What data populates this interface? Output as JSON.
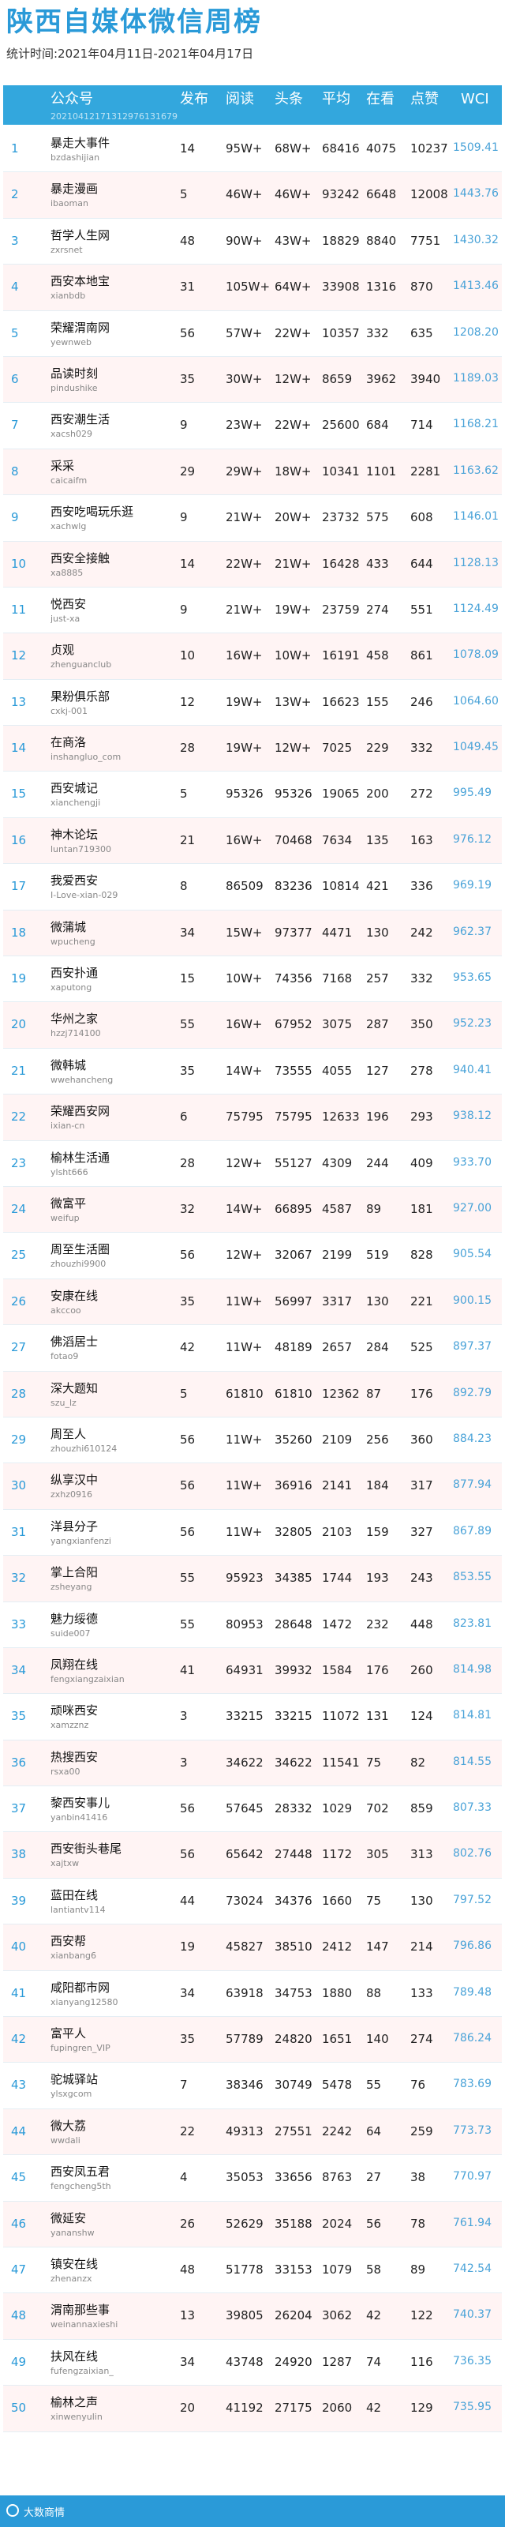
{
  "title": "陕西自媒体微信周榜",
  "subtitle": "统计时间:2021年04月11日-2021年04月17日",
  "header": {
    "name": "公众号",
    "sub": "20210412171312976131679",
    "issues": "发布",
    "reads": "阅读",
    "top": "头条",
    "avg": "平均",
    "look": "在看",
    "likes": "点赞",
    "wci": "WCI"
  },
  "rows": [
    {
      "rank": "1",
      "name": "暴走大事件",
      "acct": "bzdashijian",
      "issues": "14",
      "reads": "95W+",
      "top": "68W+",
      "avg": "68416",
      "look": "4075",
      "likes": "10237",
      "wci": "1509.41"
    },
    {
      "rank": "2",
      "name": "暴走漫画",
      "acct": "ibaoman",
      "issues": "5",
      "reads": "46W+",
      "top": "46W+",
      "avg": "93242",
      "look": "6648",
      "likes": "12008",
      "wci": "1443.76"
    },
    {
      "rank": "3",
      "name": "哲学人生网",
      "acct": "zxrsnet",
      "issues": "48",
      "reads": "90W+",
      "top": "43W+",
      "avg": "18829",
      "look": "8840",
      "likes": "7751",
      "wci": "1430.32"
    },
    {
      "rank": "4",
      "name": "西安本地宝",
      "acct": "xianbdb",
      "issues": "31",
      "reads": "105W+",
      "top": "64W+",
      "avg": "33908",
      "look": "1316",
      "likes": "870",
      "wci": "1413.46"
    },
    {
      "rank": "5",
      "name": "荣耀渭南网",
      "acct": "yewnweb",
      "issues": "56",
      "reads": "57W+",
      "top": "22W+",
      "avg": "10357",
      "look": "332",
      "likes": "635",
      "wci": "1208.20"
    },
    {
      "rank": "6",
      "name": "品读时刻",
      "acct": "pindushike",
      "issues": "35",
      "reads": "30W+",
      "top": "12W+",
      "avg": "8659",
      "look": "3962",
      "likes": "3940",
      "wci": "1189.03"
    },
    {
      "rank": "7",
      "name": "西安潮生活",
      "acct": "xacsh029",
      "issues": "9",
      "reads": "23W+",
      "top": "22W+",
      "avg": "25600",
      "look": "684",
      "likes": "714",
      "wci": "1168.21"
    },
    {
      "rank": "8",
      "name": "采采",
      "acct": "caicaifm",
      "issues": "29",
      "reads": "29W+",
      "top": "18W+",
      "avg": "10341",
      "look": "1101",
      "likes": "2281",
      "wci": "1163.62"
    },
    {
      "rank": "9",
      "name": "西安吃喝玩乐逛",
      "acct": "xachwlg",
      "issues": "9",
      "reads": "21W+",
      "top": "20W+",
      "avg": "23732",
      "look": "575",
      "likes": "608",
      "wci": "1146.01"
    },
    {
      "rank": "10",
      "name": "西安全接触",
      "acct": "xa8885",
      "issues": "14",
      "reads": "22W+",
      "top": "21W+",
      "avg": "16428",
      "look": "433",
      "likes": "644",
      "wci": "1128.13"
    },
    {
      "rank": "11",
      "name": "悦西安",
      "acct": "just-xa",
      "issues": "9",
      "reads": "21W+",
      "top": "19W+",
      "avg": "23759",
      "look": "274",
      "likes": "551",
      "wci": "1124.49"
    },
    {
      "rank": "12",
      "name": "贞观",
      "acct": "zhenguanclub",
      "issues": "10",
      "reads": "16W+",
      "top": "10W+",
      "avg": "16191",
      "look": "458",
      "likes": "861",
      "wci": "1078.09"
    },
    {
      "rank": "13",
      "name": "果粉俱乐部",
      "acct": "cxkj-001",
      "issues": "12",
      "reads": "19W+",
      "top": "13W+",
      "avg": "16623",
      "look": "155",
      "likes": "246",
      "wci": "1064.60"
    },
    {
      "rank": "14",
      "name": "在商洛",
      "acct": "inshangluo_com",
      "issues": "28",
      "reads": "19W+",
      "top": "12W+",
      "avg": "7025",
      "look": "229",
      "likes": "332",
      "wci": "1049.45"
    },
    {
      "rank": "15",
      "name": "西安城记",
      "acct": "xianchengji",
      "issues": "5",
      "reads": "95326",
      "top": "95326",
      "avg": "19065",
      "look": "200",
      "likes": "272",
      "wci": "995.49"
    },
    {
      "rank": "16",
      "name": "神木论坛",
      "acct": "luntan719300",
      "issues": "21",
      "reads": "16W+",
      "top": "70468",
      "avg": "7634",
      "look": "135",
      "likes": "163",
      "wci": "976.12"
    },
    {
      "rank": "17",
      "name": "我爱西安",
      "acct": "I-Love-xian-029",
      "issues": "8",
      "reads": "86509",
      "top": "83236",
      "avg": "10814",
      "look": "421",
      "likes": "336",
      "wci": "969.19"
    },
    {
      "rank": "18",
      "name": "微蒲城",
      "acct": "wpucheng",
      "issues": "34",
      "reads": "15W+",
      "top": "97377",
      "avg": "4471",
      "look": "130",
      "likes": "242",
      "wci": "962.37"
    },
    {
      "rank": "19",
      "name": "西安扑通",
      "acct": "xaputong",
      "issues": "15",
      "reads": "10W+",
      "top": "74356",
      "avg": "7168",
      "look": "257",
      "likes": "332",
      "wci": "953.65"
    },
    {
      "rank": "20",
      "name": "华州之家",
      "acct": "hzzj714100",
      "issues": "55",
      "reads": "16W+",
      "top": "67952",
      "avg": "3075",
      "look": "287",
      "likes": "350",
      "wci": "952.23"
    },
    {
      "rank": "21",
      "name": "微韩城",
      "acct": "wwehancheng",
      "issues": "35",
      "reads": "14W+",
      "top": "73555",
      "avg": "4055",
      "look": "127",
      "likes": "278",
      "wci": "940.41"
    },
    {
      "rank": "22",
      "name": "荣耀西安网",
      "acct": "ixian-cn",
      "issues": "6",
      "reads": "75795",
      "top": "75795",
      "avg": "12633",
      "look": "196",
      "likes": "293",
      "wci": "938.12"
    },
    {
      "rank": "23",
      "name": "榆林生活通",
      "acct": "ylsht666",
      "issues": "28",
      "reads": "12W+",
      "top": "55127",
      "avg": "4309",
      "look": "244",
      "likes": "409",
      "wci": "933.70"
    },
    {
      "rank": "24",
      "name": "微富平",
      "acct": "weifup",
      "issues": "32",
      "reads": "14W+",
      "top": "66895",
      "avg": "4587",
      "look": "89",
      "likes": "181",
      "wci": "927.00"
    },
    {
      "rank": "25",
      "name": "周至生活圈",
      "acct": "zhouzhi9900",
      "issues": "56",
      "reads": "12W+",
      "top": "32067",
      "avg": "2199",
      "look": "519",
      "likes": "828",
      "wci": "905.54"
    },
    {
      "rank": "26",
      "name": "安康在线",
      "acct": "akccoo",
      "issues": "35",
      "reads": "11W+",
      "top": "56997",
      "avg": "3317",
      "look": "130",
      "likes": "221",
      "wci": "900.15"
    },
    {
      "rank": "27",
      "name": "佛滔居士",
      "acct": "fotao9",
      "issues": "42",
      "reads": "11W+",
      "top": "48189",
      "avg": "2657",
      "look": "284",
      "likes": "525",
      "wci": "897.37"
    },
    {
      "rank": "28",
      "name": "深大题知",
      "acct": "szu_lz",
      "issues": "5",
      "reads": "61810",
      "top": "61810",
      "avg": "12362",
      "look": "87",
      "likes": "176",
      "wci": "892.79"
    },
    {
      "rank": "29",
      "name": "周至人",
      "acct": "zhouzhi610124",
      "issues": "56",
      "reads": "11W+",
      "top": "35260",
      "avg": "2109",
      "look": "256",
      "likes": "360",
      "wci": "884.23"
    },
    {
      "rank": "30",
      "name": "纵享汉中",
      "acct": "zxhz0916",
      "issues": "56",
      "reads": "11W+",
      "top": "36916",
      "avg": "2141",
      "look": "184",
      "likes": "317",
      "wci": "877.94"
    },
    {
      "rank": "31",
      "name": "洋县分子",
      "acct": "yangxianfenzi",
      "issues": "56",
      "reads": "11W+",
      "top": "32805",
      "avg": "2103",
      "look": "159",
      "likes": "327",
      "wci": "867.89"
    },
    {
      "rank": "32",
      "name": "掌上合阳",
      "acct": "zsheyang",
      "issues": "55",
      "reads": "95923",
      "top": "34385",
      "avg": "1744",
      "look": "193",
      "likes": "243",
      "wci": "853.55"
    },
    {
      "rank": "33",
      "name": "魅力绥德",
      "acct": "suide007",
      "issues": "55",
      "reads": "80953",
      "top": "28648",
      "avg": "1472",
      "look": "232",
      "likes": "448",
      "wci": "823.81"
    },
    {
      "rank": "34",
      "name": "凤翔在线",
      "acct": "fengxiangzaixian",
      "issues": "41",
      "reads": "64931",
      "top": "39932",
      "avg": "1584",
      "look": "176",
      "likes": "260",
      "wci": "814.98"
    },
    {
      "rank": "35",
      "name": "顽咪西安",
      "acct": "xamzznz",
      "issues": "3",
      "reads": "33215",
      "top": "33215",
      "avg": "11072",
      "look": "131",
      "likes": "124",
      "wci": "814.81"
    },
    {
      "rank": "36",
      "name": "热搜西安",
      "acct": "rsxa00",
      "issues": "3",
      "reads": "34622",
      "top": "34622",
      "avg": "11541",
      "look": "75",
      "likes": "82",
      "wci": "814.55"
    },
    {
      "rank": "37",
      "name": "黎西安事儿",
      "acct": "yanbin41416",
      "issues": "56",
      "reads": "57645",
      "top": "28332",
      "avg": "1029",
      "look": "702",
      "likes": "859",
      "wci": "807.33"
    },
    {
      "rank": "38",
      "name": "西安街头巷尾",
      "acct": "xajtxw",
      "issues": "56",
      "reads": "65642",
      "top": "27448",
      "avg": "1172",
      "look": "305",
      "likes": "313",
      "wci": "802.76"
    },
    {
      "rank": "39",
      "name": "蓝田在线",
      "acct": "lantiantv114",
      "issues": "44",
      "reads": "73024",
      "top": "34376",
      "avg": "1660",
      "look": "75",
      "likes": "130",
      "wci": "797.52"
    },
    {
      "rank": "40",
      "name": "西安帮",
      "acct": "xianbang6",
      "issues": "19",
      "reads": "45827",
      "top": "38510",
      "avg": "2412",
      "look": "147",
      "likes": "214",
      "wci": "796.86"
    },
    {
      "rank": "41",
      "name": "咸阳都市网",
      "acct": "xianyang12580",
      "issues": "34",
      "reads": "63918",
      "top": "34753",
      "avg": "1880",
      "look": "88",
      "likes": "133",
      "wci": "789.48"
    },
    {
      "rank": "42",
      "name": "富平人",
      "acct": "fupingren_VIP",
      "issues": "35",
      "reads": "57789",
      "top": "24820",
      "avg": "1651",
      "look": "140",
      "likes": "274",
      "wci": "786.24"
    },
    {
      "rank": "43",
      "name": "驼城驿站",
      "acct": "ylsxgcom",
      "issues": "7",
      "reads": "38346",
      "top": "30749",
      "avg": "5478",
      "look": "55",
      "likes": "76",
      "wci": "783.69"
    },
    {
      "rank": "44",
      "name": "微大荔",
      "acct": "wwdali",
      "issues": "22",
      "reads": "49313",
      "top": "27551",
      "avg": "2242",
      "look": "64",
      "likes": "259",
      "wci": "773.73"
    },
    {
      "rank": "45",
      "name": "西安凤五君",
      "acct": "fengcheng5th",
      "issues": "4",
      "reads": "35053",
      "top": "33656",
      "avg": "8763",
      "look": "27",
      "likes": "38",
      "wci": "770.97"
    },
    {
      "rank": "46",
      "name": "微延安",
      "acct": "yananshw",
      "issues": "26",
      "reads": "52629",
      "top": "35188",
      "avg": "2024",
      "look": "56",
      "likes": "78",
      "wci": "761.94"
    },
    {
      "rank": "47",
      "name": "镇安在线",
      "acct": "zhenanzx",
      "issues": "48",
      "reads": "51778",
      "top": "33153",
      "avg": "1079",
      "look": "58",
      "likes": "89",
      "wci": "742.54"
    },
    {
      "rank": "48",
      "name": "渭南那些事",
      "acct": "weinannaxieshi",
      "issues": "13",
      "reads": "39805",
      "top": "26204",
      "avg": "3062",
      "look": "42",
      "likes": "122",
      "wci": "740.37"
    },
    {
      "rank": "49",
      "name": "扶风在线",
      "acct": "fufengzaixian_",
      "issues": "34",
      "reads": "43748",
      "top": "24920",
      "avg": "1287",
      "look": "74",
      "likes": "116",
      "wci": "736.35"
    },
    {
      "rank": "50",
      "name": "榆林之声",
      "acct": "xinwenyulin",
      "issues": "20",
      "reads": "41192",
      "top": "27175",
      "avg": "2060",
      "look": "42",
      "likes": "129",
      "wci": "735.95"
    }
  ],
  "footer": {
    "brand": "大数商情"
  }
}
